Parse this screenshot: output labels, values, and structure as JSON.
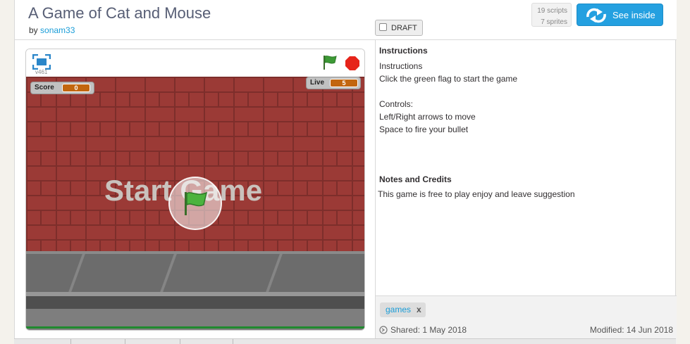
{
  "project": {
    "title": "A Game of Cat and Mouse",
    "by_label": "by",
    "author": "sonam33",
    "draft_label": "DRAFT"
  },
  "stats": {
    "scripts": "19 scripts",
    "sprites": "7 sprites"
  },
  "see_inside_label": "See inside",
  "player": {
    "version": "v461",
    "monitors": {
      "score_label": "Score",
      "score_value": "0",
      "live_label": "Live",
      "live_value": "5"
    },
    "start_text": "Start Game"
  },
  "instructions": {
    "heading": "Instructions",
    "lines": [
      "Instructions",
      "Click the green flag to start the game",
      "",
      "Controls:",
      "Left/Right arrows to move",
      "Space to fire your bullet"
    ]
  },
  "notes": {
    "heading": "Notes and Credits",
    "text": "This game is free to play enjoy and leave suggestion"
  },
  "tags": [
    {
      "name": "games",
      "remove": "x"
    }
  ],
  "dates": {
    "shared": "Shared: 1 May 2018",
    "modified": "Modified: 14 Jun 2018"
  },
  "colors": {
    "accent": "#24a0e0",
    "link": "#1a9dd8",
    "brick": "#9b3a36",
    "stop": "#e6241a",
    "flag": "#3d9a36"
  }
}
